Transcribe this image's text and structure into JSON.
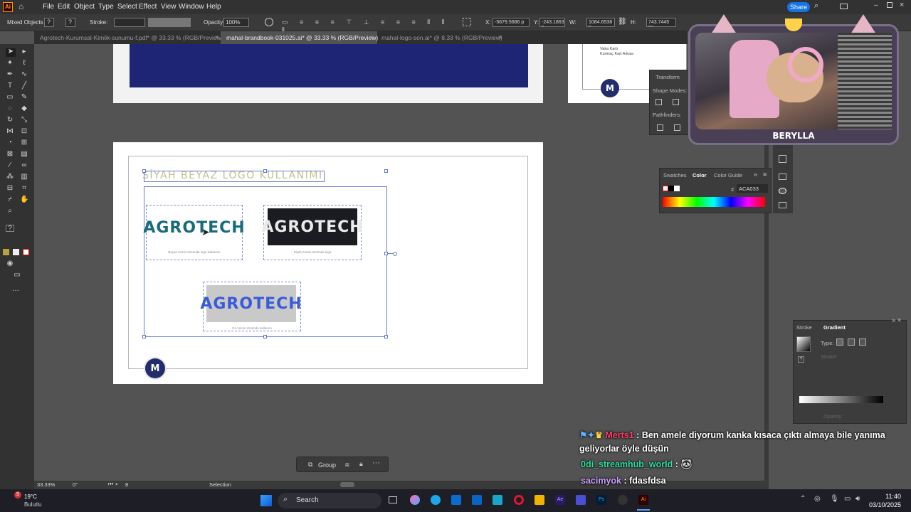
{
  "menu": {
    "app_icon": "Ai",
    "items": [
      "File",
      "Edit",
      "Object",
      "Type",
      "Select",
      "Effect",
      "View",
      "Window",
      "Help"
    ],
    "share": "Share"
  },
  "control_bar": {
    "selection_type": "Mixed Objects",
    "stroke_label": "Stroke:",
    "opacity_label": "Opacity:",
    "opacity_value": "100%",
    "x_label": "X:",
    "x_value": "-5679.5686 p",
    "y_label": "Y:",
    "y_value": "-243.1863 p",
    "w_label": "W:",
    "w_value": "1084.6538 p",
    "h_label": "H:",
    "h_value": "743.7445 px"
  },
  "tabs": [
    {
      "label": "Agrotech-Kurumsal-Kimlik-sunumu-f.pdf* @ 33.33 % (RGB/Preview)",
      "close": "×"
    },
    {
      "label": "mahal-brandbook-031025.ai* @ 33.33 % (RGB/Preview)",
      "close": "×"
    },
    {
      "label": "mahal-logo-son.ai* @ 8.33 % (RGB/Preview)",
      "close": "×"
    }
  ],
  "artboard": {
    "heading": "SİYAH BEYAZ LOGO KULLANIMI",
    "logo_text": "AGROTECH",
    "caption_1": "Beyaz zemin üzerinde logo kullanımı",
    "caption_2": "Siyah zemin üzerinde logo",
    "caption_3": "Gri zemin üzerinde kullanım",
    "monogram": "M"
  },
  "side_artboard_text": [
    "Vaka Kartı",
    "Kurmaç Kart Arkası"
  ],
  "panels": {
    "transform": {
      "title": "Transform",
      "shape_modes": "Shape Modes:",
      "pathfinders": "Pathfinders:"
    },
    "color": {
      "tabs": [
        "Swatches",
        "Color",
        "Color Guide"
      ],
      "hash": "#",
      "hex": "ACA033"
    },
    "gradient": {
      "tabs": [
        "Stroke",
        "Gradient"
      ],
      "type_label": "Type:",
      "stroke_label": "Stroke:",
      "opacity_label": "Opacity:"
    }
  },
  "context_bar": {
    "group_label": "Group"
  },
  "status": {
    "zoom": "33.33%",
    "rotation": "0°",
    "page": "8",
    "tool": "Selection"
  },
  "webcam": {
    "name": "BERYLLA"
  },
  "chat": [
    {
      "user": "Merts1",
      "sep": ":",
      "text": "Ben amele diyorum kanka kısaca çıktı almaya bile yanıma",
      "text2": "geliyorlar öyle düşün",
      "color": "#ff3d6e"
    },
    {
      "user": "0di_streamhub_world",
      "sep": ":",
      "text": "",
      "color": "#2fe0a0"
    },
    {
      "user": "sacimyok",
      "sep": ":",
      "text": "fdasfdsa",
      "color": "#c9a0ff"
    }
  ],
  "taskbar": {
    "weather_temp": "19°C",
    "weather_desc": "Bulutlu",
    "badge": "9",
    "search": "Search",
    "time": "11:40",
    "date": "03/10/2025"
  },
  "colors": {
    "accent": "#1473e6",
    "navy": "#1d2574",
    "logo_teal": "#1a6b7a",
    "logo_blue": "#3a5bd9"
  }
}
